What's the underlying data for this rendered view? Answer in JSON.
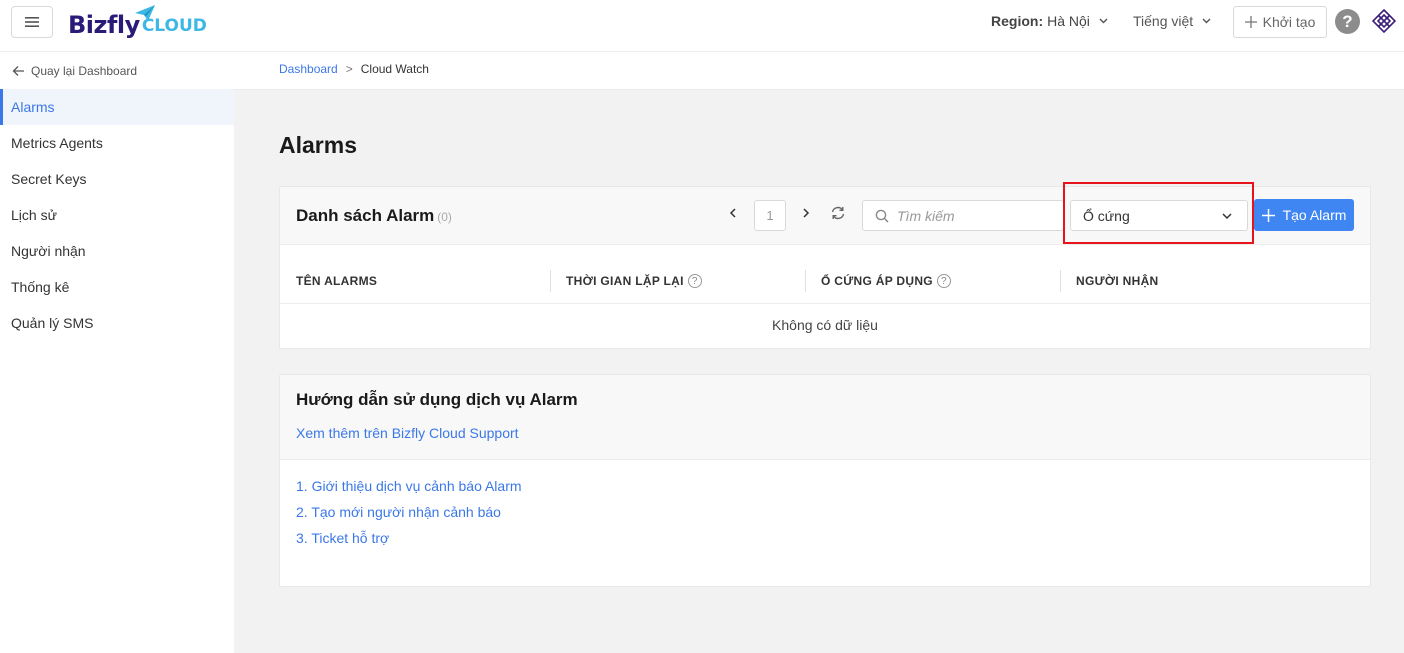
{
  "header": {
    "logo_main": "Bizfly",
    "logo_sub": "CLOUD",
    "region_label": "Region:",
    "region_value": "Hà Nội",
    "language": "Tiếng việt",
    "create_label": "Khởi tạo",
    "help_label": "?"
  },
  "sidebar": {
    "back_label": "Quay lại Dashboard",
    "items": [
      {
        "label": "Alarms",
        "active": true
      },
      {
        "label": "Metrics Agents"
      },
      {
        "label": "Secret Keys"
      },
      {
        "label": "Lịch sử"
      },
      {
        "label": "Người nhận"
      },
      {
        "label": "Thống kê"
      },
      {
        "label": "Quản lý SMS"
      }
    ]
  },
  "breadcrumb": {
    "home": "Dashboard",
    "separator": ">",
    "current": "Cloud Watch"
  },
  "page": {
    "title": "Alarms"
  },
  "alarm_list": {
    "title": "Danh sách Alarm",
    "count": "(0)",
    "page_number": "1",
    "search_placeholder": "Tìm kiếm",
    "filter_selected": "Ổ cứng",
    "add_button": "Tạo Alarm",
    "columns": [
      "TÊN ALARMS",
      "THỜI GIAN LẶP LẠI",
      "Ổ CỨNG ÁP DỤNG",
      "NGƯỜI NHẬN"
    ],
    "empty_text": "Không có dữ liệu"
  },
  "guide": {
    "title": "Hướng dẫn sử dụng dịch vụ Alarm",
    "support_link": "Xem thêm trên Bizfly Cloud Support",
    "items": [
      "1. Giới thiệu dịch vụ cảnh báo Alarm",
      "2. Tạo mới người nhận cảnh báo",
      "3. Ticket hỗ trợ"
    ]
  },
  "colors": {
    "accent": "#3f86f3",
    "highlight": "#e8141c",
    "brand_dark": "#2b1b78",
    "brand_light": "#3db7e4"
  }
}
